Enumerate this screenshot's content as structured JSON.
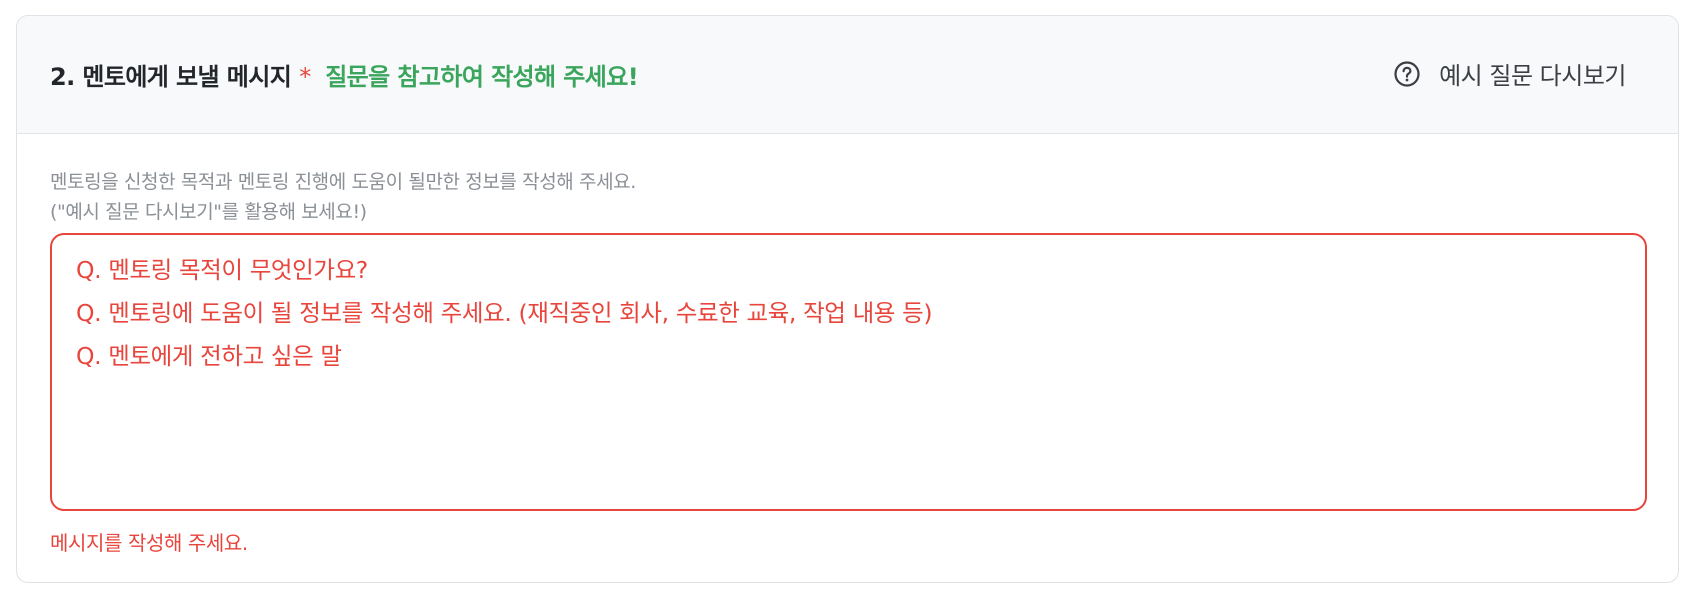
{
  "header": {
    "title": "2. 멘토에게 보낼 메시지",
    "required_mark": "*",
    "hint": "질문을 참고하여 작성해 주세요!",
    "example_button_label": "예시 질문 다시보기",
    "example_button_icon": "question-circle-icon"
  },
  "body": {
    "guide_line_1": "멘토링을 신청한 목적과 멘토링 진행에 도움이 될만한 정보를 작성해 주세요.",
    "guide_line_2": "(\"예시 질문 다시보기\"를 활용해 보세요!)",
    "message": {
      "value": "",
      "placeholder_lines": [
        "Q. 멘토링 목적이 무엇인가요?",
        "Q. 멘토링에 도움이 될 정보를 작성해 주세요. (재직중인 회사, 수료한 교육, 작업 내용 등)",
        "Q. 멘토에게 전하고 싶은 말"
      ]
    },
    "error_message": "메시지를 작성해 주세요."
  },
  "colors": {
    "error": "#e8453c",
    "hint_green": "#3aa55c",
    "header_bg": "#f8f9fa",
    "guide_text": "#8b9096",
    "title_text": "#222529"
  }
}
